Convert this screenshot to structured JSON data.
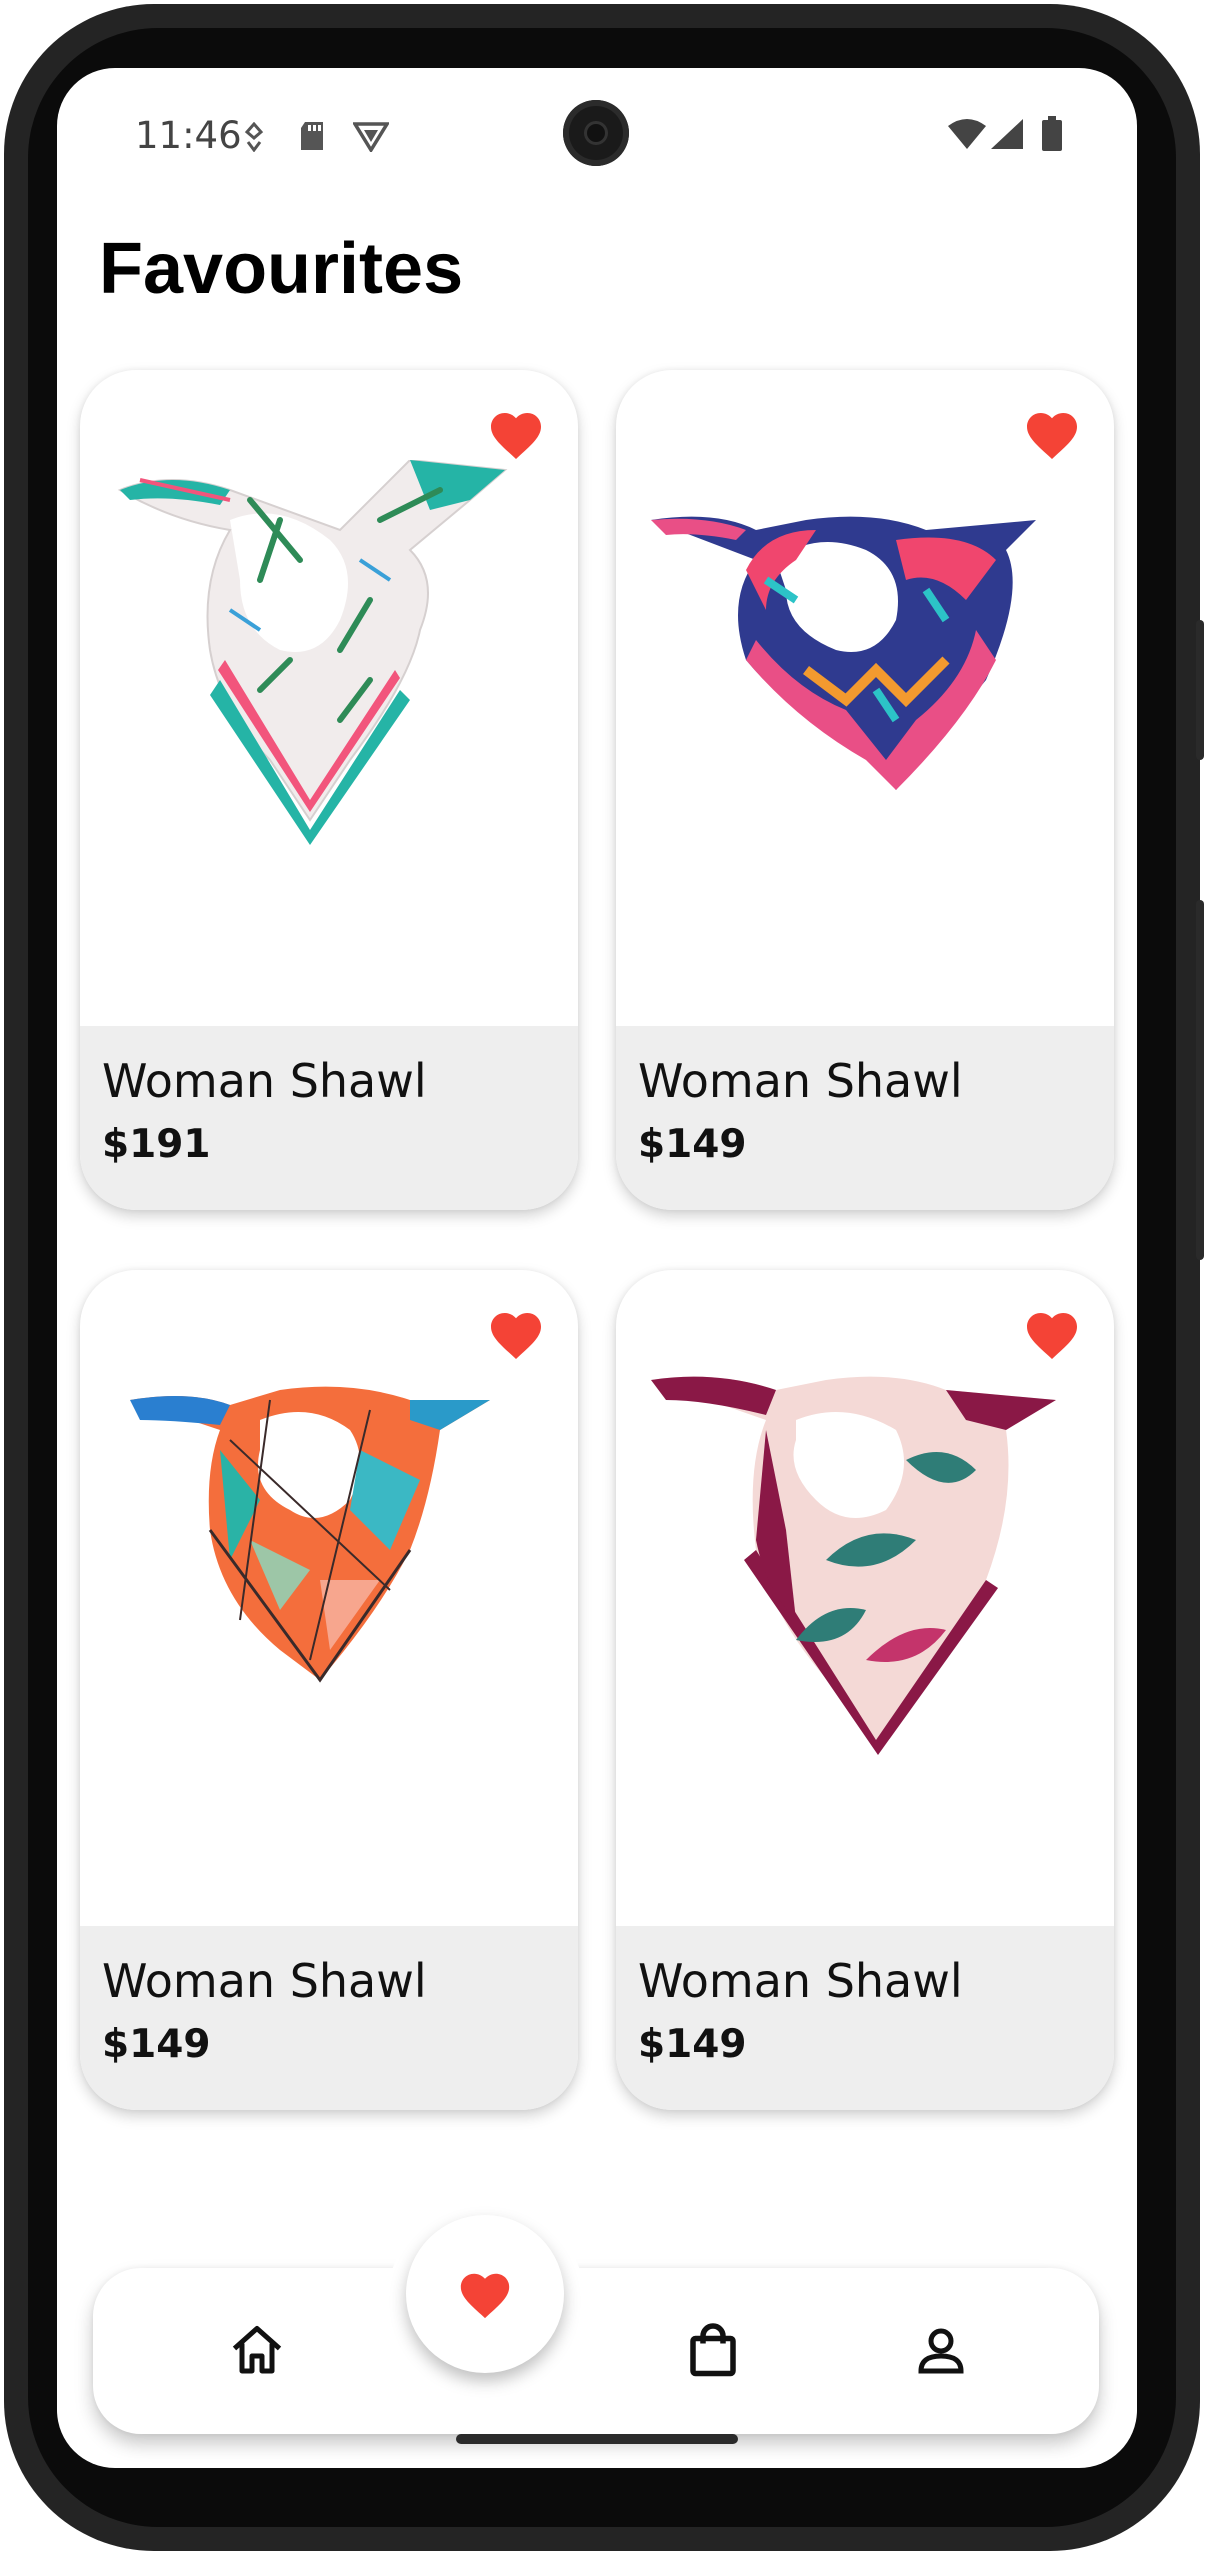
{
  "status_bar": {
    "time": "11:46"
  },
  "page": {
    "title": "Favourites"
  },
  "products": [
    {
      "name": "Woman Shawl",
      "price": "$191",
      "favourited": true,
      "image": "floral-white-teal-scarf"
    },
    {
      "name": "Woman Shawl",
      "price": "$149",
      "favourited": true,
      "image": "blue-pink-abstract-scarf"
    },
    {
      "name": "Woman Shawl",
      "price": "$149",
      "favourited": true,
      "image": "geometric-multicolor-scarf"
    },
    {
      "name": "Woman Shawl",
      "price": "$149",
      "favourited": true,
      "image": "plum-leaf-print-scarf"
    }
  ],
  "bottom_nav": {
    "items": [
      {
        "icon": "home-icon"
      },
      {
        "icon": "heart-icon",
        "active": true
      },
      {
        "icon": "shopping-bag-icon"
      },
      {
        "icon": "person-icon"
      }
    ]
  },
  "colors": {
    "heart": "#f44336",
    "card_info_bg": "#eeeeee",
    "text": "#111111"
  }
}
